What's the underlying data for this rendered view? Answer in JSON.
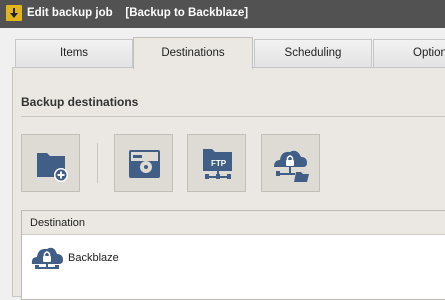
{
  "window": {
    "title": "Edit backup job",
    "job_name": "[Backup to Backblaze]"
  },
  "tabs": [
    {
      "label": "Items"
    },
    {
      "label": "Destinations"
    },
    {
      "label": "Scheduling"
    },
    {
      "label": "Option"
    }
  ],
  "active_tab": "Destinations",
  "section": {
    "title": "Backup destinations"
  },
  "destination_buttons": [
    {
      "icon": "add-folder-icon"
    },
    {
      "icon": "disk-drive-icon"
    },
    {
      "icon": "ftp-icon",
      "label": "FTP"
    },
    {
      "icon": "cloud-folder-icon"
    }
  ],
  "list": {
    "column_header": "Destination",
    "rows": [
      {
        "icon": "cloud-lock-icon",
        "label": "Backblaze"
      }
    ]
  },
  "colors": {
    "titlebar": "#525252",
    "accent_icon": "#415f86",
    "panel": "#ebe8e3"
  }
}
